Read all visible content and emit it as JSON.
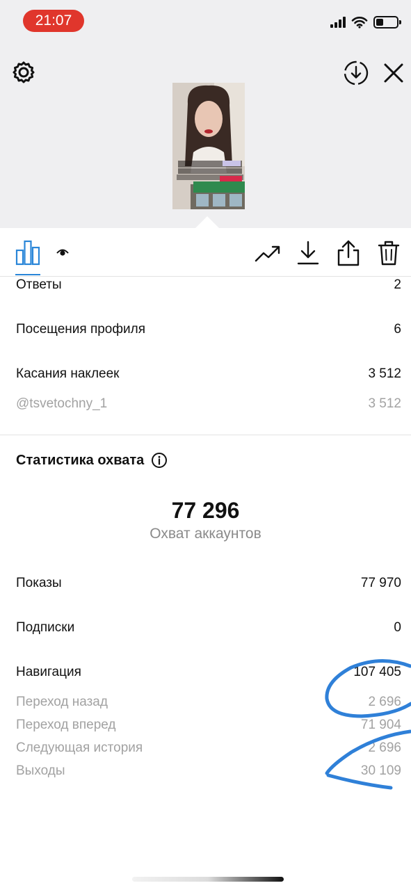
{
  "status_bar": {
    "time": "21:07"
  },
  "stats": [
    {
      "label": "Ответы",
      "value": "2"
    },
    {
      "label": "Посещения профиля",
      "value": "6"
    },
    {
      "label": "Касания наклеек",
      "value": "3 512"
    },
    {
      "label": "@tsvetochny_1",
      "value": "3 512"
    }
  ],
  "reach": {
    "title": "Статистика охвата",
    "accounts_reached": "77 296",
    "accounts_reached_label": "Охват аккаунтов",
    "rows": [
      {
        "label": "Показы",
        "value": "77 970"
      },
      {
        "label": "Подписки",
        "value": "0"
      },
      {
        "label": "Навигация",
        "value": "107 405"
      }
    ],
    "navigation_details": [
      {
        "label": "Переход назад",
        "value": "2 696"
      },
      {
        "label": "Переход вперед",
        "value": "71 904"
      },
      {
        "label": "Следующая история",
        "value": "2 696"
      },
      {
        "label": "Выходы",
        "value": "30 109"
      }
    ]
  },
  "colors": {
    "accent": "#2a86d8",
    "status_pill": "#e0362c",
    "annotation": "#2f80d8"
  }
}
